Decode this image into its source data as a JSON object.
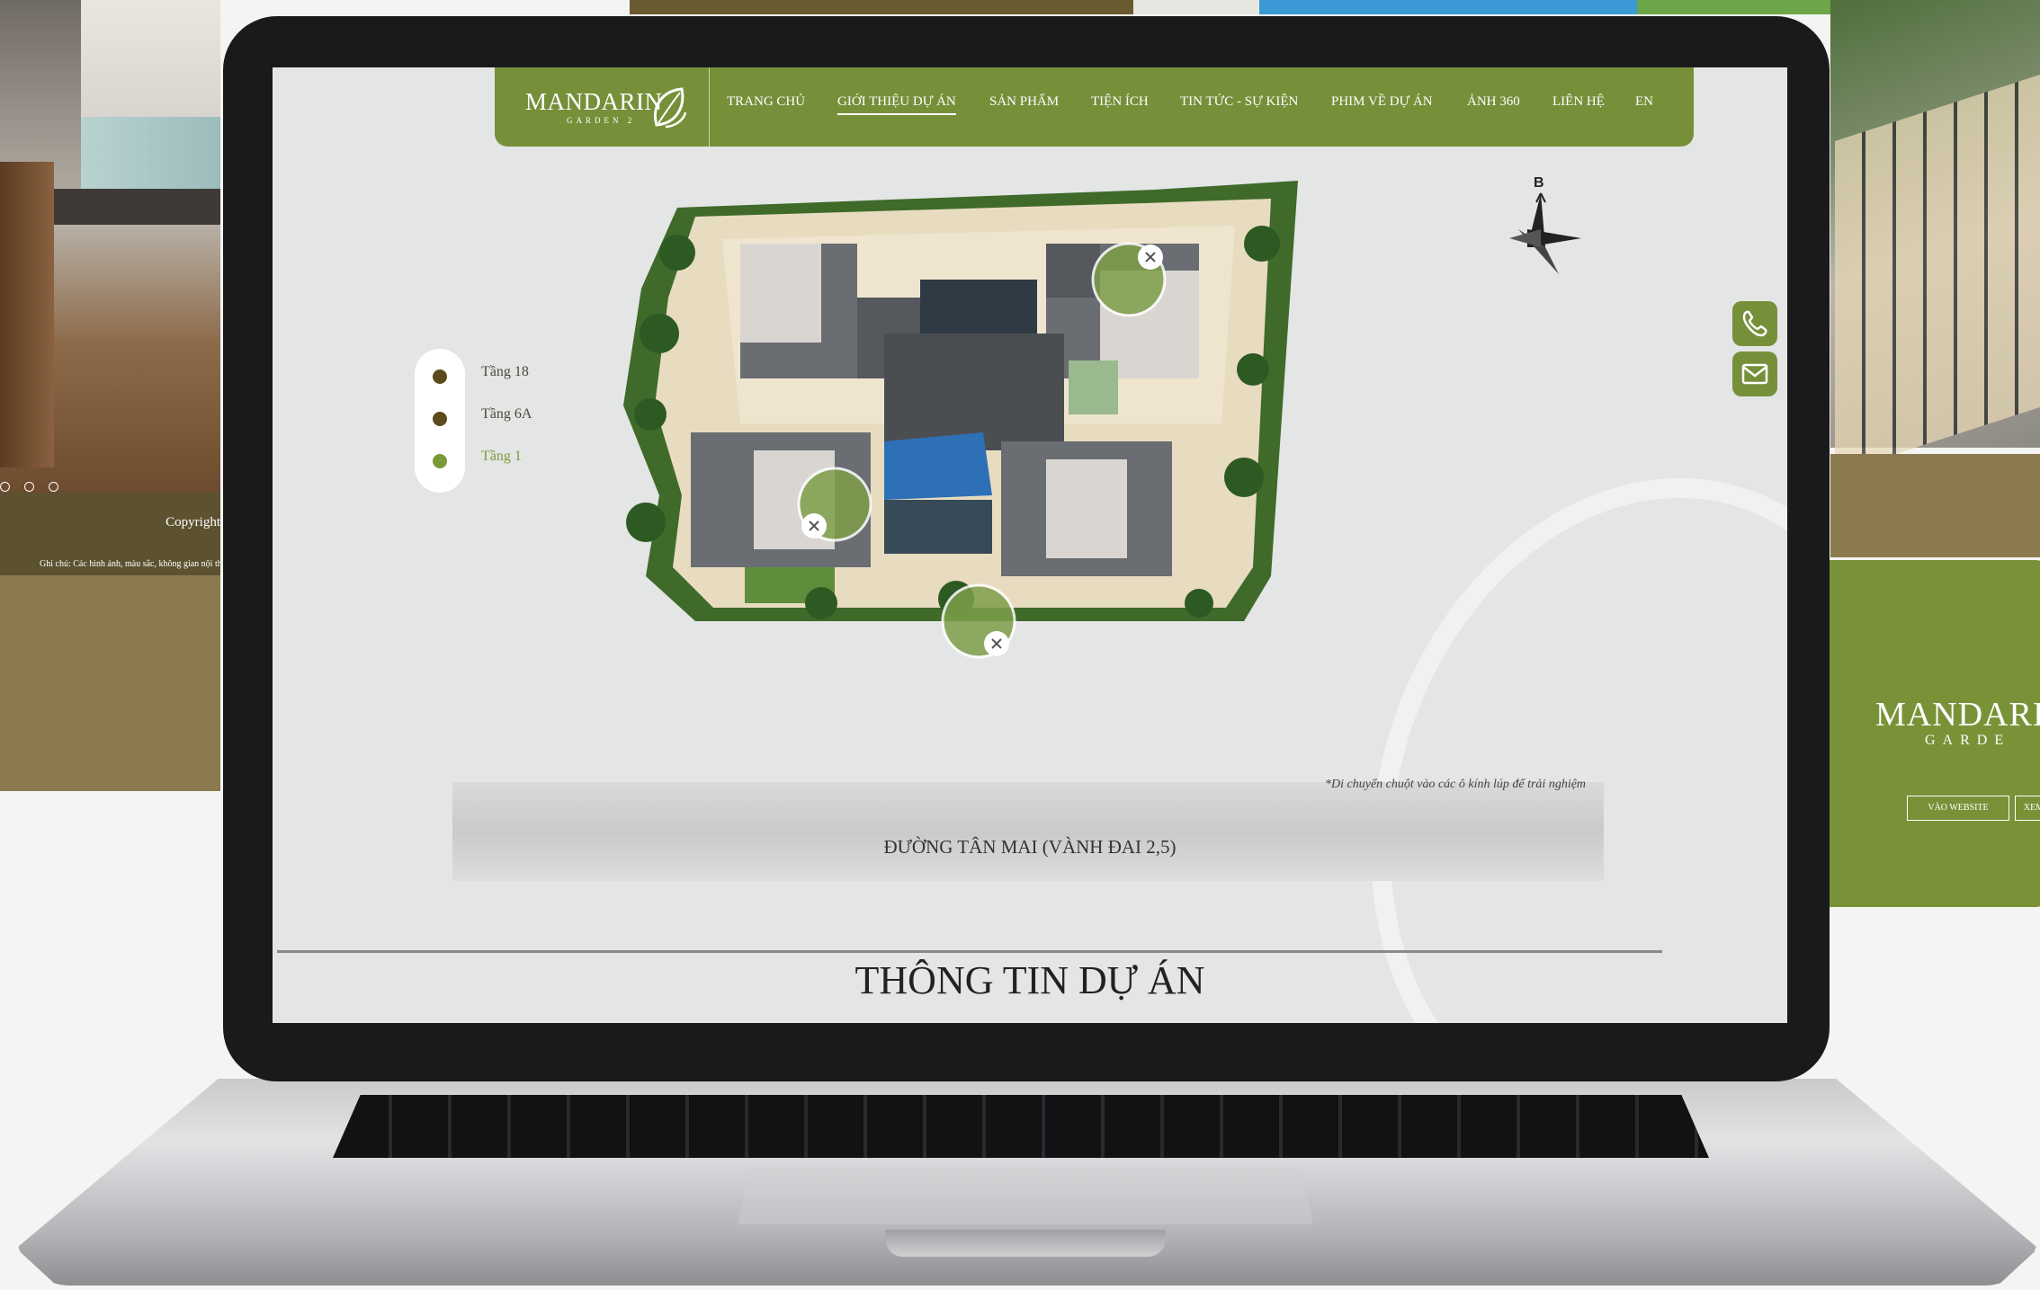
{
  "background": {
    "copyright": "Copyright",
    "disclaimer": "Ghi chú: Các hình ảnh, màu sắc, không gian nội th",
    "card_logo": "MANDARI",
    "card_logo_sub": "GARDE",
    "card_buttons": [
      "VÀO WEBSITE",
      "XEM"
    ]
  },
  "site": {
    "logo": "MANDARIN",
    "logo_sub": "GARDEN 2",
    "nav": [
      "TRANG CHỦ",
      "GIỚI THIỆU DỰ ÁN",
      "SẢN PHẨM",
      "TIỆN ÍCH",
      "TIN TỨC - SỰ KIỆN",
      "PHIM VỀ DỰ ÁN",
      "ẢNH 360",
      "LIÊN HỆ",
      "EN"
    ],
    "active_nav": "GIỚI THIỆU DỰ ÁN",
    "floors": [
      "Tầng 18",
      "Tầng 6A",
      "Tầng 1"
    ],
    "compass_label": "B",
    "hint": "*Di chuyển chuột vào các ô kính lúp để trải nghiệm",
    "road": "ĐƯỜNG TÂN MAI (VÀNH ĐAI 2,5)",
    "section_title": "THÔNG TIN DỰ ÁN",
    "colors": {
      "brand": "#76903a",
      "floor_dark": "#5b4a1c",
      "floor_green": "#7a9a3a"
    }
  },
  "icons": [
    "phone-icon",
    "mail-icon",
    "close-icon",
    "leaf-logo-icon",
    "compass-icon"
  ]
}
